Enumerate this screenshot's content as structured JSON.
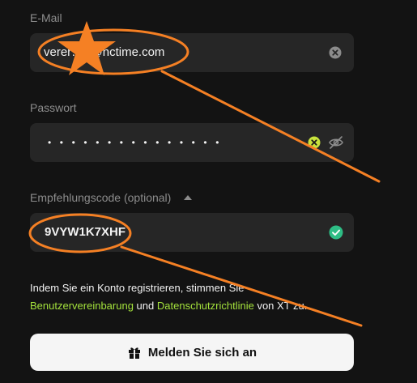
{
  "form": {
    "email": {
      "label": "E-Mail",
      "value": "verer…o@nctime.com",
      "clear_icon": "clear-circle-icon"
    },
    "password": {
      "label": "Passwort",
      "masked_value": "•••••••••••••••",
      "status_icon": "error-circle-icon",
      "visibility_icon": "eye-off-icon"
    },
    "referral": {
      "label": "Empfehlungscode (optional)",
      "toggle_icon": "chevron-up-icon",
      "value": "9VYW1K7XHF",
      "status_icon": "check-circle-icon"
    },
    "terms": {
      "prefix": "Indem Sie ein Konto registrieren, stimmen Sie",
      "link_agreement": "Benutzervereinbarung",
      "and": "und",
      "link_privacy": "Datenschutzrichtlinie",
      "suffix": "von XT zu."
    },
    "submit": {
      "label": "Melden Sie sich an",
      "icon": "gift-icon"
    }
  },
  "colors": {
    "background": "#131313",
    "field_bg": "#262626",
    "accent_green": "#a4e23c",
    "check_green": "#2ebd85",
    "annotation_orange": "#f58024",
    "button_bg": "#f5f5f5"
  },
  "annotations": {
    "star_icon": "star-icon"
  }
}
